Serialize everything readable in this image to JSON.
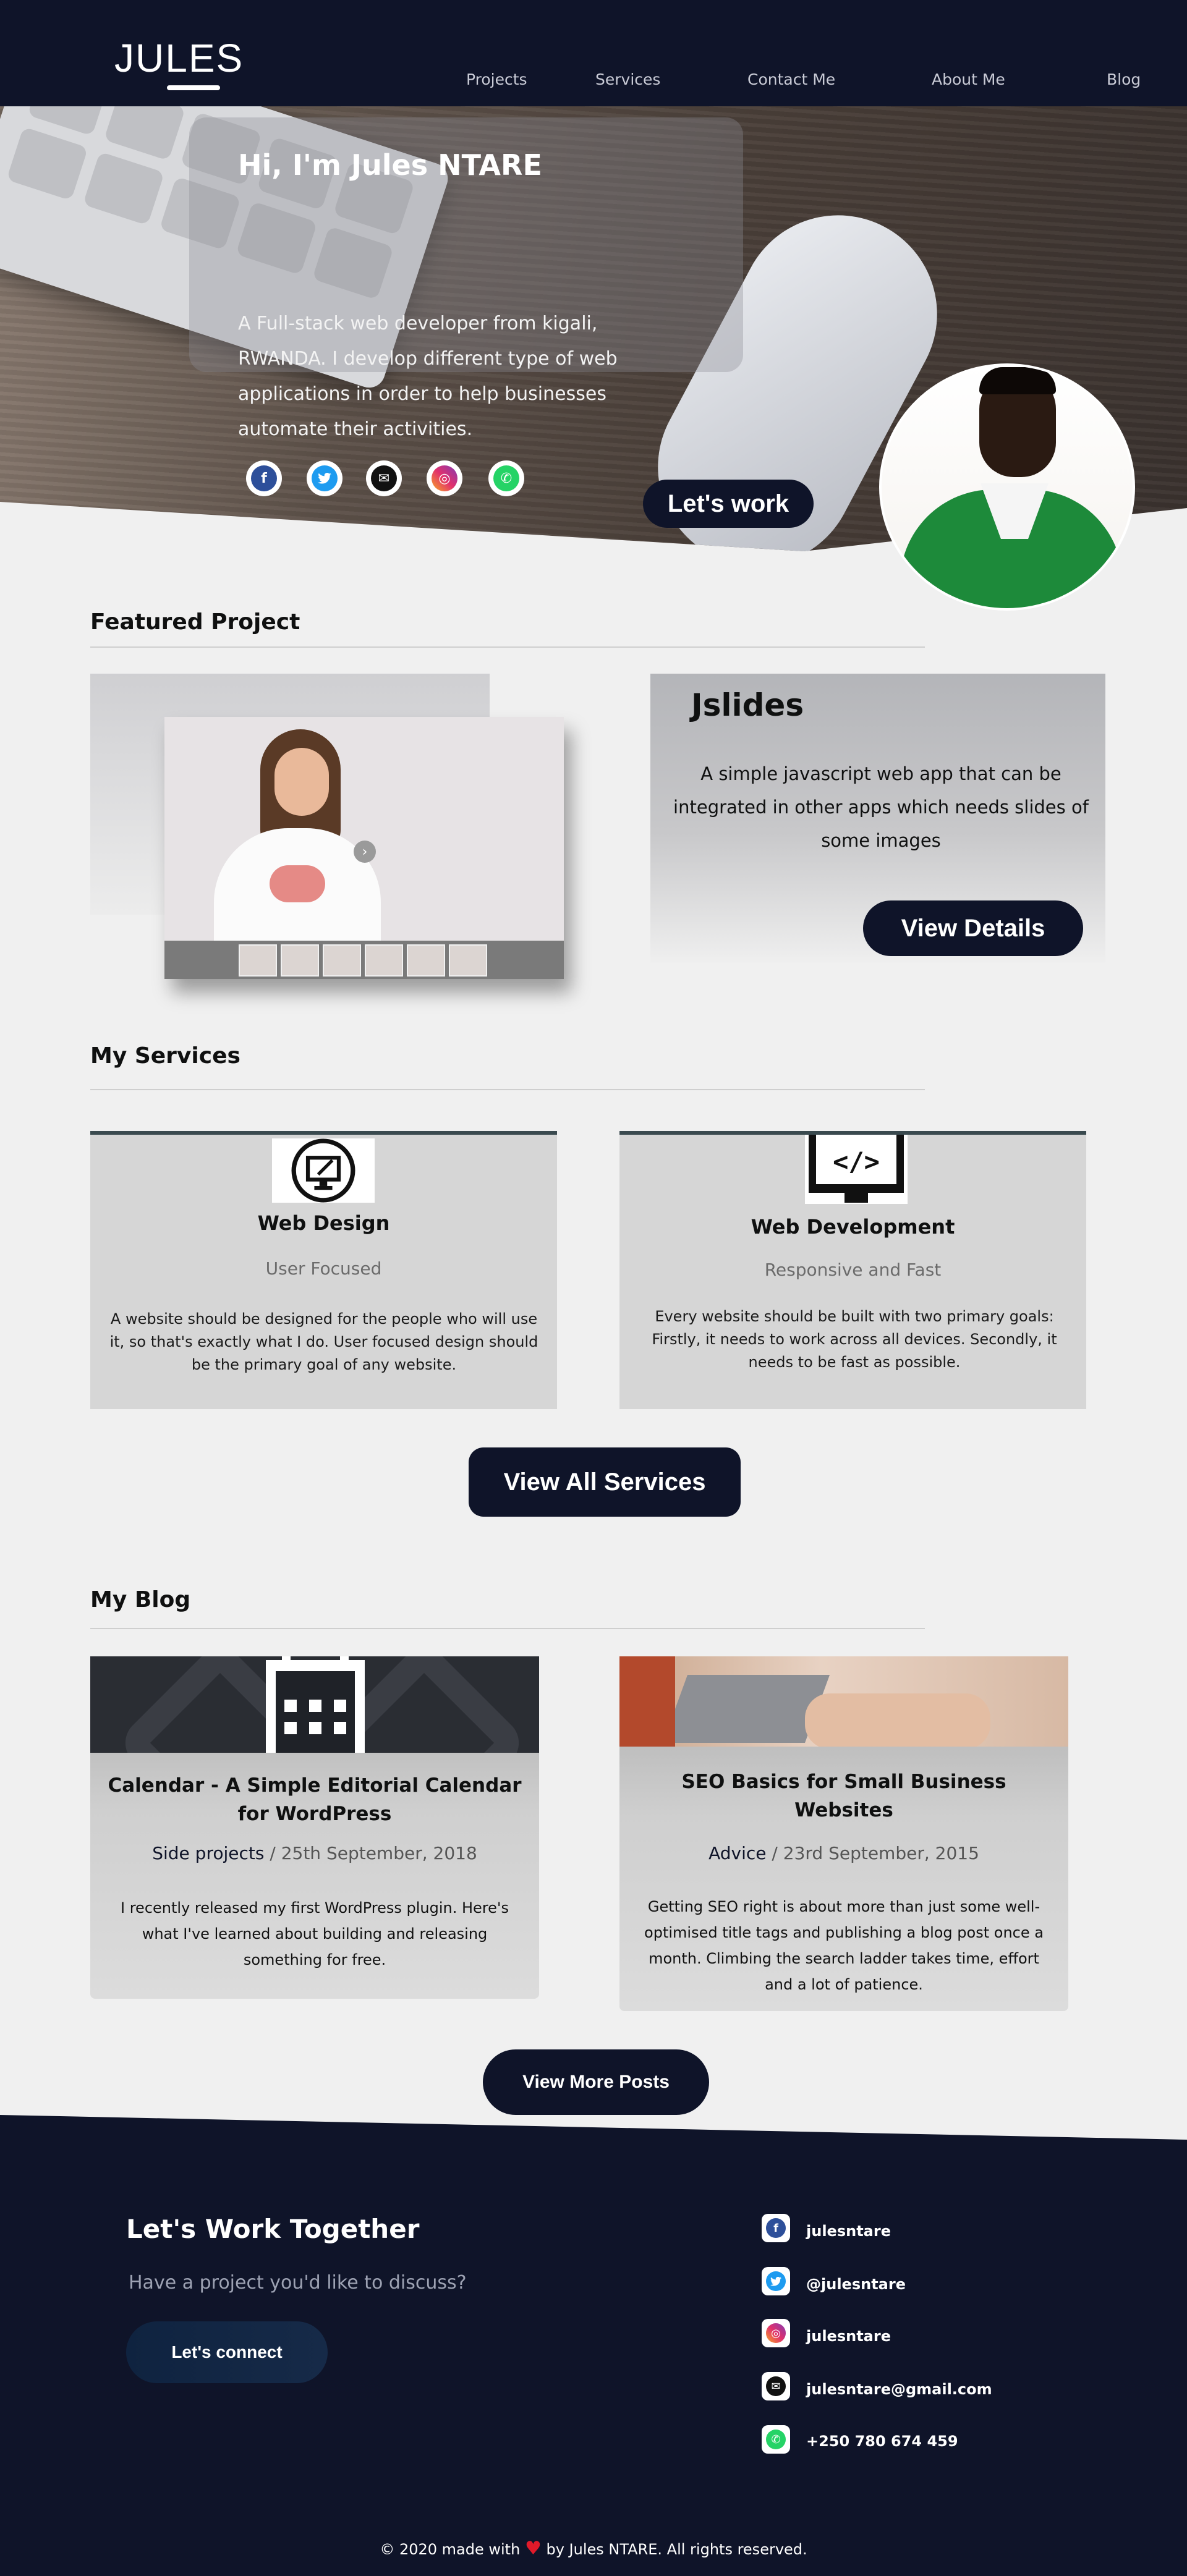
{
  "nav": {
    "logo": "JULES",
    "links": [
      "Projects",
      "Services",
      "Contact Me",
      "About Me",
      "Blog"
    ]
  },
  "hero": {
    "title": "Hi, I'm Jules NTARE",
    "lines": [
      "A Full-stack web developer from kigali,",
      "RWANDA. I develop different type of web",
      "applications in order to help businesses",
      "automate their activities."
    ],
    "social_icons": [
      "facebook-icon",
      "twitter-icon",
      "email-icon",
      "instagram-icon",
      "whatsapp-icon"
    ],
    "cta": "Let's work"
  },
  "featured": {
    "heading": "Featured Project",
    "project_name": "Jslides",
    "description": "A simple javascript web app that can be integrated in other apps which needs slides of some images",
    "cta": "View Details"
  },
  "services": {
    "heading": "My Services",
    "items": [
      {
        "icon": "monitor-design-icon",
        "name": "Web Design",
        "tagline": "User Focused",
        "description": "A website should be designed for the people who will use it, so that's exactly what I do. User focused design should be the primary goal of any website."
      },
      {
        "icon": "code-monitor-icon",
        "name": "Web Development",
        "tagline": "Responsive and Fast",
        "description": "Every website should be built with two primary goals: Firstly, it needs to work across all devices. Secondly, it needs to be fast as possible."
      }
    ],
    "cta": "View All Services"
  },
  "blog": {
    "heading": "My Blog",
    "posts": [
      {
        "title": "Calendar - A Simple Editorial Calendar for WordPress",
        "category": "Side projects",
        "date": "25th September, 2018",
        "excerpt": "I recently released my first WordPress plugin. Here's what I've learned about building and releasing something for free."
      },
      {
        "title": "SEO Basics for Small Business Websites",
        "category": "Advice",
        "date": "23rd September, 2015",
        "excerpt": "Getting SEO right is about more than just some well-optimised title tags and publishing a blog post once a month. Climbing the search ladder takes time, effort and a lot of patience."
      }
    ],
    "cta": "View More Posts"
  },
  "footer": {
    "title": "Let's Work Together",
    "subtitle": "Have a project you'd like to discuss?",
    "cta": "Let's connect",
    "contacts": [
      {
        "icon": "facebook-icon",
        "text": "julesntare"
      },
      {
        "icon": "twitter-icon",
        "text": "@julesntare"
      },
      {
        "icon": "instagram-icon",
        "text": "julesntare"
      },
      {
        "icon": "email-icon",
        "text": "julesntare@gmail.com"
      },
      {
        "icon": "whatsapp-icon",
        "text": "+250 780 674 459"
      }
    ],
    "copyright_before": "© 2020 made with",
    "copyright_after": "by Jules NTARE. All rights reserved."
  },
  "colors": {
    "navy": "#0f1429",
    "page_bg": "#f0f0f0",
    "card_grey": "#d6d6d6",
    "heart": "#e01a2a"
  }
}
